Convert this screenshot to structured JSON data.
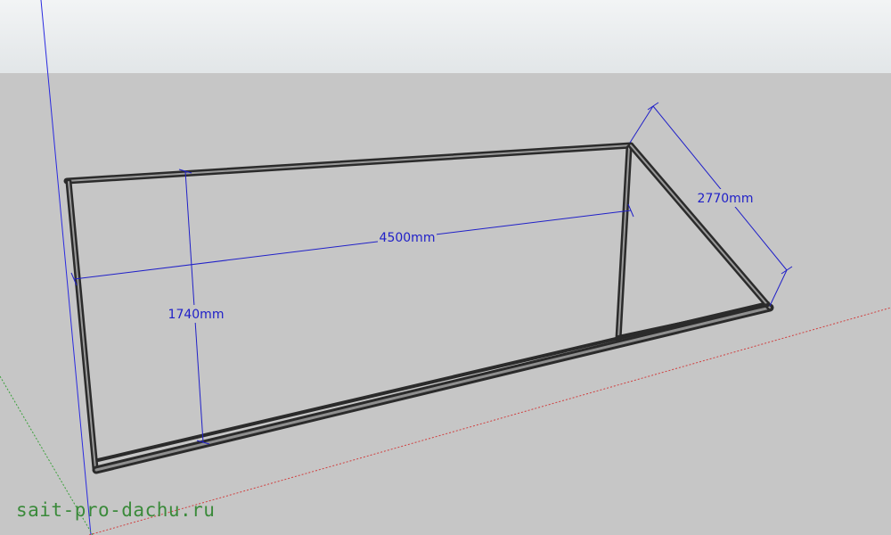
{
  "dimensions": {
    "length": "4500mm",
    "height": "1740mm",
    "depth": "2770mm"
  },
  "watermark": "sait-pro-dachu.ru",
  "colors": {
    "sky": "#eef0f1",
    "ground": "#c6c6c6",
    "frame": "#2b2b2b",
    "frame_fill": "#8f8f8f",
    "dimension": "#2020c8",
    "axis_blue": "#2a2ae0",
    "axis_red": "#d04040",
    "axis_green": "#3aa03a",
    "watermark": "#3a8a3a"
  }
}
